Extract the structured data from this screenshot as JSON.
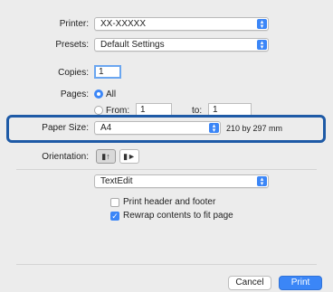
{
  "printer": {
    "label": "Printer:",
    "value": "XX-XXXXX"
  },
  "presets": {
    "label": "Presets:",
    "value": "Default Settings"
  },
  "copies": {
    "label": "Copies:",
    "value": "1"
  },
  "pages": {
    "label": "Pages:",
    "all_label": "All",
    "from_label": "From:",
    "from_value": "1",
    "to_label": "to:",
    "to_value": "1"
  },
  "paper_size": {
    "label": "Paper Size:",
    "value": "A4",
    "dimensions": "210 by 297 mm"
  },
  "orientation": {
    "label": "Orientation:",
    "portrait_icon": "portrait-orientation-icon",
    "landscape_icon": "landscape-orientation-icon"
  },
  "app_options": {
    "value": "TextEdit",
    "print_header_footer": {
      "label": "Print header and footer",
      "checked": false
    },
    "rewrap_contents": {
      "label": "Rewrap contents to fit page",
      "checked": true
    }
  },
  "buttons": {
    "cancel": "Cancel",
    "print": "Print"
  },
  "colors": {
    "accent": "#3b86f7",
    "highlight_border": "#1e5aa6"
  }
}
